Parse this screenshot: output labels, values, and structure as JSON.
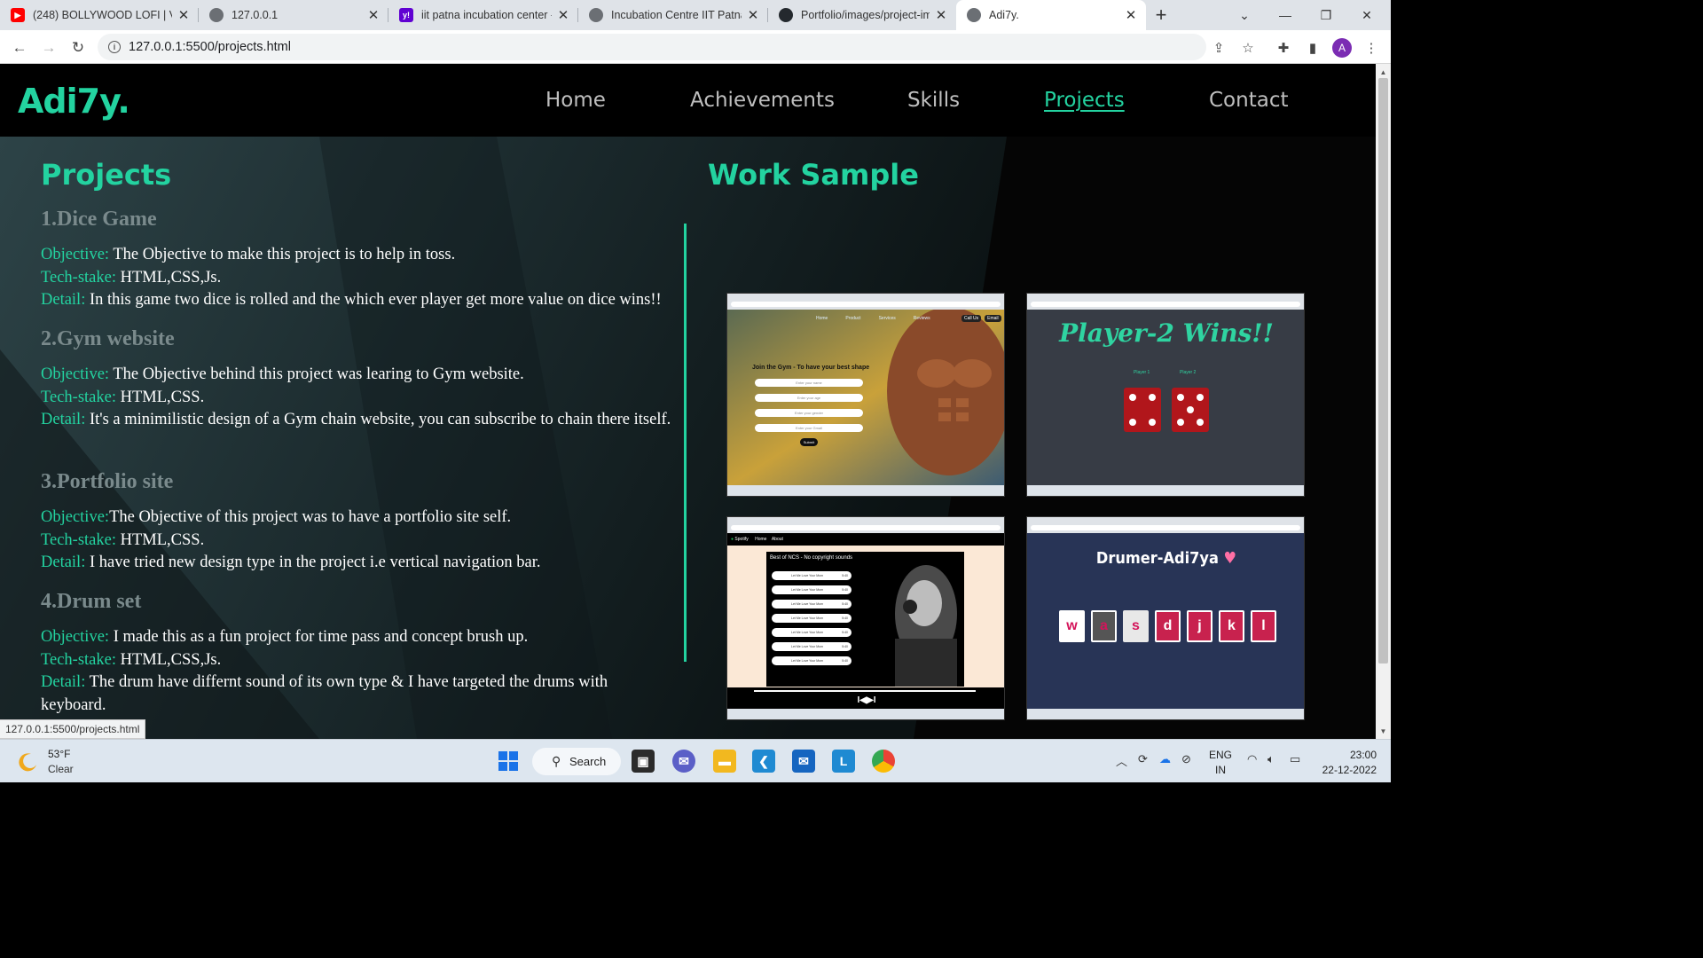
{
  "browser": {
    "tabs": [
      {
        "title": "(248) BOLLYWOOD LOFI | V",
        "favicon": "youtube-icon",
        "color": "#ff0000"
      },
      {
        "title": "127.0.0.1",
        "favicon": "globe-icon",
        "color": "#5f6368"
      },
      {
        "title": "iit patna incubation center -",
        "favicon": "yahoo-icon",
        "color": "#6001d2"
      },
      {
        "title": "Incubation Centre IIT Patna",
        "favicon": "globe-icon",
        "color": "#5f6368"
      },
      {
        "title": "Portfolio/images/project-im",
        "favicon": "github-icon",
        "color": "#24292e"
      },
      {
        "title": "Adi7y.",
        "favicon": "globe-icon",
        "color": "#5f6368"
      }
    ],
    "url": "127.0.0.1:5500/projects.html",
    "profile_initial": "A",
    "status_url": "127.0.0.1:5500/projects.html"
  },
  "site": {
    "logo": "Adi7y.",
    "nav": [
      "Home",
      "Achievements",
      "Skills",
      "Projects",
      "Contact"
    ],
    "active_nav": "Projects",
    "accent": "#23d3a0"
  },
  "projects_heading": "Projects",
  "work_heading": "Work Sample",
  "projects": [
    {
      "title": "1.Dice Game",
      "objective_label": "Objective:",
      "objective": " The Objective to make this project is to help in toss.",
      "tech_label": "Tech-stake:",
      "tech": " HTML,CSS,Js.",
      "detail_label": "Detail:",
      "detail": " In this game two dice is rolled and the which ever player get more value on dice wins!!"
    },
    {
      "title": "2.Gym website",
      "objective_label": "Objective:",
      "objective": " The Objective behind this project was learing to Gym website.",
      "tech_label": "Tech-stake:",
      "tech": " HTML,CSS.",
      "detail_label": "Detail:",
      "detail": " It's a minimilistic design of a Gym chain website, you can subscribe to chain there itself."
    },
    {
      "title": "3.Portfolio site",
      "objective_label": "Objective:",
      "objective": "The Objective of this project was to have a portfolio site self.",
      "tech_label": "Tech-stake:",
      "tech": " HTML,CSS.",
      "detail_label": "Detail:",
      "detail": " I have tried new design type in the project i.e vertical navigation bar."
    },
    {
      "title": "4.Drum set",
      "objective_label": "Objective:",
      "objective": " I made this as a fun project for time pass and concept brush up.",
      "tech_label": "Tech-stake:",
      "tech": " HTML,CSS,Js.",
      "detail_label": "Detail:",
      "detail": " The drum have differnt sound of its own type & I have targeted the drums with keyboard."
    }
  ],
  "samples": {
    "gym": {
      "nav": [
        "Home",
        "Product",
        "Services",
        "Reviews"
      ],
      "buttons": [
        "Call Us",
        "Email"
      ],
      "heading": "Join the Gym - To have your best shape",
      "fields": [
        "Enter your name",
        "Enter your age",
        "Enter your gender",
        "Enter your Gmail"
      ],
      "submit": "Submit"
    },
    "dice": {
      "heading": "Player-2 Wins!!",
      "players": [
        "Player 1",
        "Player 2"
      ]
    },
    "music": {
      "brand": "Spotify",
      "links": [
        "Home",
        "About"
      ],
      "playlist_title": "Best of NCS - No copyright sounds",
      "song": "Let Me Love Your Mom",
      "duration": "5:40",
      "controls": "I◀▶I"
    },
    "drum": {
      "heading": "Drumer-Adi7ya",
      "keys": [
        "w",
        "a",
        "s",
        "d",
        "j",
        "k",
        "l"
      ]
    }
  },
  "taskbar": {
    "temperature": "53°F",
    "weather": "Clear",
    "search": "Search",
    "lang_top": "ENG",
    "lang_bottom": "IN",
    "time": "23:00",
    "date": "22-12-2022"
  }
}
